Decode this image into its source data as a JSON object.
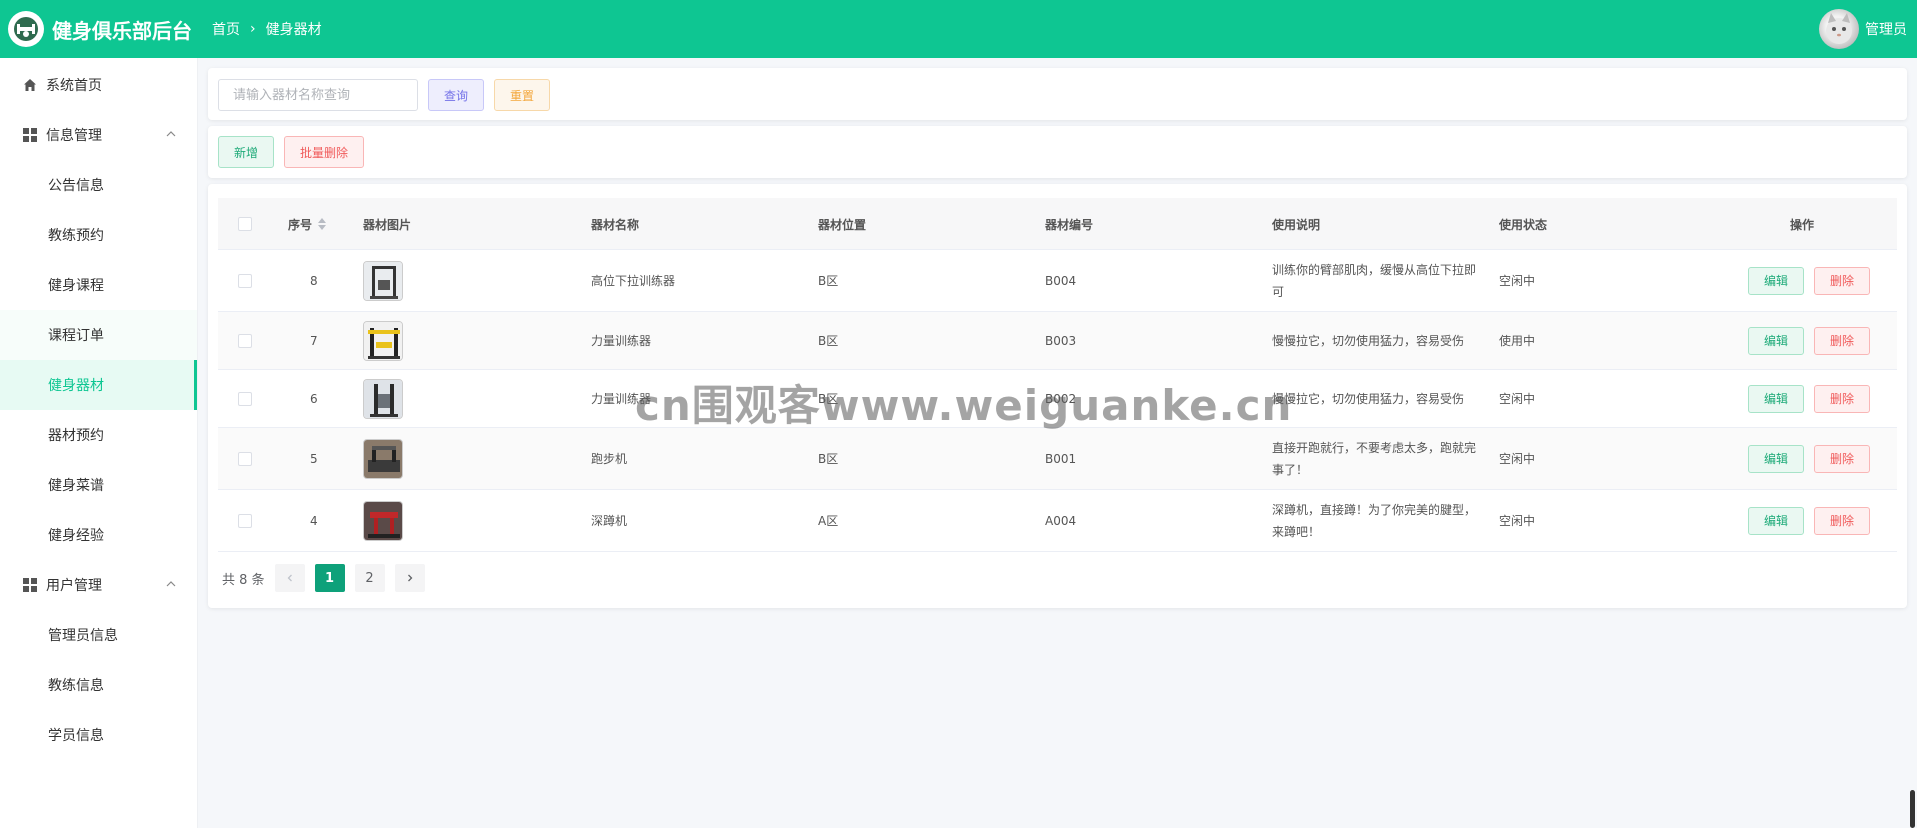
{
  "header": {
    "app_title": "健身俱乐部后台",
    "breadcrumb": [
      "首页",
      "健身器材"
    ],
    "user_name": "管理员",
    "brand_color": "#0ec692"
  },
  "sidebar": {
    "home": "系统首页",
    "groups": [
      {
        "label": "信息管理",
        "items": [
          "公告信息",
          "教练预约",
          "健身课程",
          "课程订单",
          "健身器材",
          "器材预约",
          "健身菜谱",
          "健身经验"
        ]
      },
      {
        "label": "用户管理",
        "items": [
          "管理员信息",
          "教练信息",
          "学员信息"
        ]
      }
    ],
    "active_item": "健身器材"
  },
  "search": {
    "placeholder": "请输入器材名称查询",
    "query_label": "查询",
    "reset_label": "重置"
  },
  "actions": {
    "add_label": "新增",
    "batch_delete_label": "批量删除"
  },
  "table": {
    "columns": [
      "序号",
      "器材图片",
      "器材名称",
      "器材位置",
      "器材编号",
      "使用说明",
      "使用状态",
      "操作"
    ],
    "rows": [
      {
        "id": "8",
        "name": "高位下拉训练器",
        "location": "B区",
        "code": "B004",
        "desc": "训练你的臂部肌肉，缓慢从高位下拉即可",
        "status": "空闲中"
      },
      {
        "id": "7",
        "name": "力量训练器",
        "location": "B区",
        "code": "B003",
        "desc": "慢慢拉它，切勿使用猛力，容易受伤",
        "status": "使用中"
      },
      {
        "id": "6",
        "name": "力量训练器",
        "location": "B区",
        "code": "B002",
        "desc": "慢慢拉它，切勿使用猛力，容易受伤",
        "status": "空闲中"
      },
      {
        "id": "5",
        "name": "跑步机",
        "location": "B区",
        "code": "B001",
        "desc": "直接开跑就行，不要考虑太多，跑就完事了！",
        "status": "空闲中"
      },
      {
        "id": "4",
        "name": "深蹲机",
        "location": "A区",
        "code": "A004",
        "desc": "深蹲机，直接蹲！为了你完美的腱型，来蹲吧！",
        "status": "空闲中"
      }
    ],
    "edit_label": "编辑",
    "delete_label": "删除"
  },
  "pagination": {
    "total_text": "共 8 条",
    "pages": [
      "1",
      "2"
    ],
    "current": "1"
  },
  "watermark": "cn围观客www.weiguanke.cn"
}
